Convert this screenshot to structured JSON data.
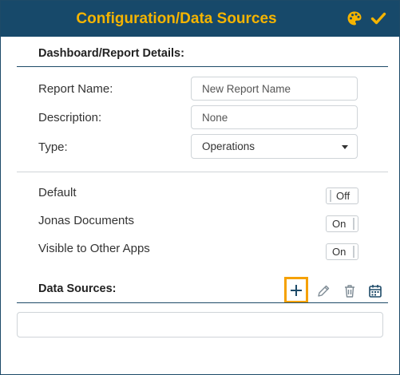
{
  "header": {
    "title": "Configuration/Data Sources",
    "palette_icon": "palette-icon",
    "check_icon": "check-icon"
  },
  "details": {
    "section_title": "Dashboard/Report Details:",
    "report_name": {
      "label": "Report Name:",
      "placeholder": "New Report Name"
    },
    "description": {
      "label": "Description:",
      "placeholder": "None"
    },
    "type": {
      "label": "Type:",
      "value": "Operations"
    }
  },
  "toggles": {
    "default": {
      "label": "Default",
      "state": "Off"
    },
    "jonas_documents": {
      "label": "Jonas Documents",
      "state": "On"
    },
    "visible_other_apps": {
      "label": "Visible to Other Apps",
      "state": "On"
    }
  },
  "data_sources": {
    "section_title": "Data Sources:"
  },
  "colors": {
    "header_bg": "#17496a",
    "accent": "#f5b400",
    "highlight": "#f5a100"
  }
}
